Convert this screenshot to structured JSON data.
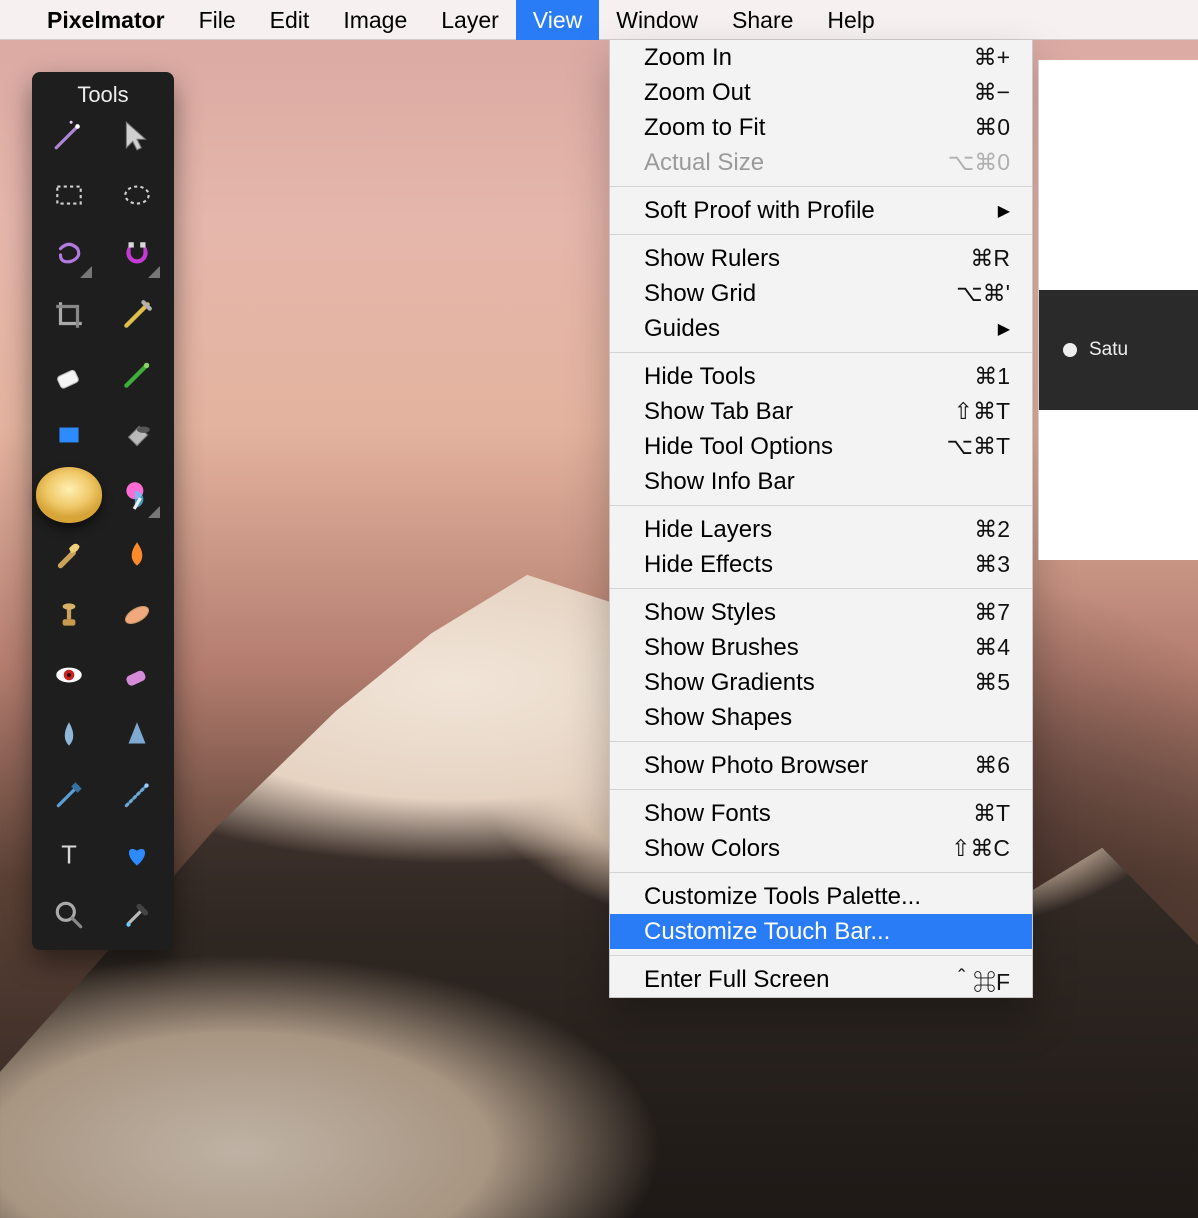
{
  "menubar": {
    "app": "Pixelmator",
    "items": [
      "File",
      "Edit",
      "Image",
      "Layer",
      "View",
      "Window",
      "Share",
      "Help"
    ],
    "selected_index": 4
  },
  "tools_panel": {
    "title": "Tools",
    "tools": [
      {
        "id": "magic-wand",
        "name": "magic-wand-tool"
      },
      {
        "id": "move",
        "name": "move-tool"
      },
      {
        "id": "rect-marquee",
        "name": "rectangular-marquee-tool"
      },
      {
        "id": "ellipse-marquee",
        "name": "elliptical-marquee-tool"
      },
      {
        "id": "lasso",
        "name": "lasso-tool",
        "corner": true
      },
      {
        "id": "magnetic",
        "name": "magnetic-selection-tool",
        "corner": true
      },
      {
        "id": "crop",
        "name": "crop-tool"
      },
      {
        "id": "slice",
        "name": "slice-tool"
      },
      {
        "id": "eraser",
        "name": "eraser-tool"
      },
      {
        "id": "brush",
        "name": "brush-tool"
      },
      {
        "id": "shape",
        "name": "shape-tool"
      },
      {
        "id": "bucket",
        "name": "paint-bucket-tool"
      },
      {
        "id": "sponge",
        "name": "sponge-tool",
        "badge": true
      },
      {
        "id": "candy",
        "name": "pixel-tool",
        "corner": true
      },
      {
        "id": "smudge",
        "name": "smudge-tool"
      },
      {
        "id": "drop",
        "name": "blur-tool"
      },
      {
        "id": "stamp",
        "name": "clone-stamp-tool"
      },
      {
        "id": "heal",
        "name": "heal-tool"
      },
      {
        "id": "redeye",
        "name": "red-eye-tool"
      },
      {
        "id": "gum",
        "name": "sharpen-tool"
      },
      {
        "id": "droplet",
        "name": "droplet-tool"
      },
      {
        "id": "cone",
        "name": "gradient-tool"
      },
      {
        "id": "pen",
        "name": "pen-tool"
      },
      {
        "id": "path",
        "name": "path-tool"
      },
      {
        "id": "text",
        "name": "type-tool"
      },
      {
        "id": "heart",
        "name": "favorite-tool"
      },
      {
        "id": "zoom",
        "name": "zoom-tool"
      },
      {
        "id": "eyedrop",
        "name": "eyedropper-tool"
      }
    ]
  },
  "view_menu": {
    "groups": [
      [
        {
          "label": "Zoom In",
          "shortcut": "⌘+"
        },
        {
          "label": "Zoom Out",
          "shortcut": "⌘−"
        },
        {
          "label": "Zoom to Fit",
          "shortcut": "⌘0"
        },
        {
          "label": "Actual Size",
          "shortcut": "⌥⌘0",
          "disabled": true
        }
      ],
      [
        {
          "label": "Soft Proof with Profile",
          "submenu": true
        }
      ],
      [
        {
          "label": "Show Rulers",
          "shortcut": "⌘R"
        },
        {
          "label": "Show Grid",
          "shortcut": "⌥⌘'"
        },
        {
          "label": "Guides",
          "submenu": true
        }
      ],
      [
        {
          "label": "Hide Tools",
          "shortcut": "⌘1"
        },
        {
          "label": "Show Tab Bar",
          "shortcut": "⇧⌘T"
        },
        {
          "label": "Hide Tool Options",
          "shortcut": "⌥⌘T"
        },
        {
          "label": "Show Info Bar"
        }
      ],
      [
        {
          "label": "Hide Layers",
          "shortcut": "⌘2"
        },
        {
          "label": "Hide Effects",
          "shortcut": "⌘3"
        }
      ],
      [
        {
          "label": "Show Styles",
          "shortcut": "⌘7"
        },
        {
          "label": "Show Brushes",
          "shortcut": "⌘4"
        },
        {
          "label": "Show Gradients",
          "shortcut": "⌘5"
        },
        {
          "label": "Show Shapes"
        }
      ],
      [
        {
          "label": "Show Photo Browser",
          "shortcut": "⌘6"
        }
      ],
      [
        {
          "label": "Show Fonts",
          "shortcut": "⌘T"
        },
        {
          "label": "Show Colors",
          "shortcut": "⇧⌘C"
        }
      ],
      [
        {
          "label": "Customize Tools Palette..."
        },
        {
          "label": "Customize Touch Bar...",
          "highlight": true
        }
      ],
      [
        {
          "label": "Enter Full Screen",
          "shortcut": "＾⌘F"
        }
      ]
    ]
  },
  "side_panel": {
    "row_label": "Satu"
  }
}
